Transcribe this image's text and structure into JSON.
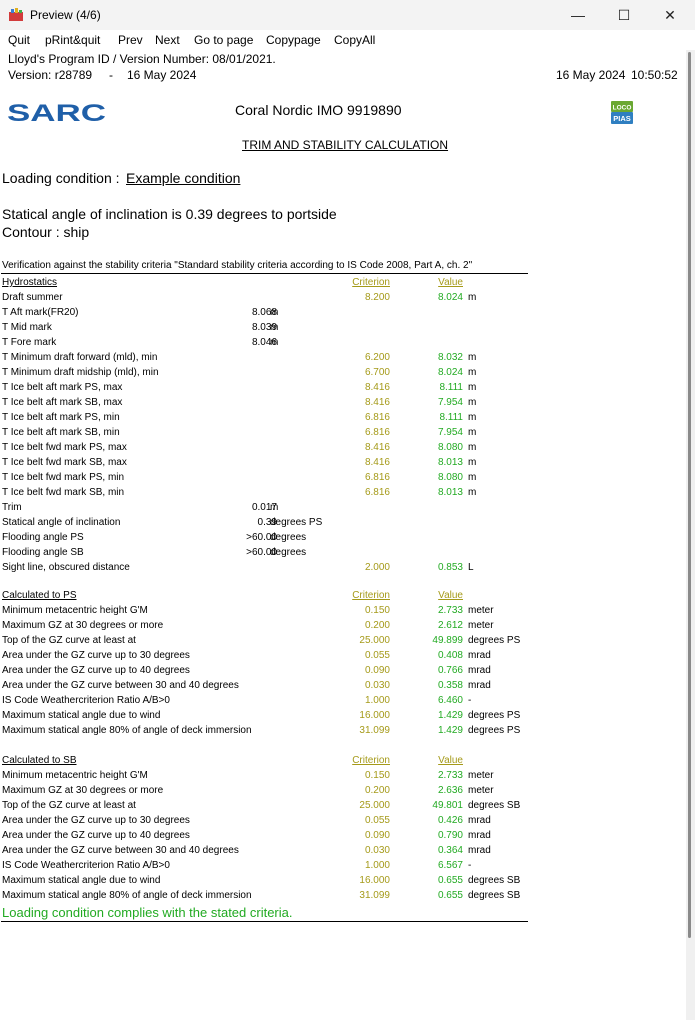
{
  "window": {
    "title": "Preview (4/6)",
    "min_symbol": "—",
    "max_symbol": "☐",
    "close_symbol": "✕",
    "icon": "app-icon"
  },
  "menu": [
    "Quit",
    "pRint&quit",
    "Prev",
    "Next",
    "Go to page",
    "Copypage",
    "CopyAll"
  ],
  "header": {
    "program_id": "Lloyd's Program ID / Version Number: 08/01/2021.",
    "version": "Version: r28789",
    "dash": "-",
    "version_date": "16 May 2024",
    "print_date": "16 May 2024",
    "print_time": "10:50:52",
    "company_logo": "SARC",
    "vessel": "Coral Nordic IMO 9919890",
    "badge_top": "LOCO",
    "badge_bottom": "PIAS",
    "report_title": "TRIM AND STABILITY CALCULATION"
  },
  "loading": {
    "label": "Loading condition :",
    "name": "Example condition",
    "statical": "Statical angle of inclination is 0.39 degrees to portside",
    "contour": "Contour : ship"
  },
  "verification": "Verification against the stability criteria \"Standard stability criteria according to IS Code 2008, Part A, ch. 2\"",
  "hydro": {
    "heading": "Hydrostatics",
    "criterion_header": "Criterion",
    "value_header": "Value",
    "rows": [
      {
        "label": "Draft summer",
        "crit": "8.200",
        "value": "8.024",
        "unit": "m"
      },
      {
        "label": "T Aft mark(FR20)",
        "mid": "8.068",
        "midunit": "m"
      },
      {
        "label": "T Mid mark",
        "mid": "8.039",
        "midunit": "m"
      },
      {
        "label": "T Fore mark",
        "mid": "8.046",
        "midunit": "m"
      },
      {
        "label": "T Minimum draft forward (mld), min",
        "crit": "6.200",
        "value": "8.032",
        "unit": "m"
      },
      {
        "label": "T Minimum draft midship (mld), min",
        "crit": "6.700",
        "value": "8.024",
        "unit": "m"
      },
      {
        "label": "T Ice belt aft mark PS, max",
        "crit": "8.416",
        "value": "8.111",
        "unit": "m"
      },
      {
        "label": "T Ice belt aft mark SB, max",
        "crit": "8.416",
        "value": "7.954",
        "unit": "m"
      },
      {
        "label": "T Ice belt aft mark PS, min",
        "crit": "6.816",
        "value": "8.111",
        "unit": "m"
      },
      {
        "label": "T Ice belt aft mark SB, min",
        "crit": "6.816",
        "value": "7.954",
        "unit": "m"
      },
      {
        "label": "T Ice belt fwd mark PS, max",
        "crit": "8.416",
        "value": "8.080",
        "unit": "m"
      },
      {
        "label": "T Ice belt fwd mark SB, max",
        "crit": "8.416",
        "value": "8.013",
        "unit": "m"
      },
      {
        "label": "T Ice belt fwd mark PS, min",
        "crit": "6.816",
        "value": "8.080",
        "unit": "m"
      },
      {
        "label": "T Ice belt fwd mark SB, min",
        "crit": "6.816",
        "value": "8.013",
        "unit": "m"
      },
      {
        "label": "Trim",
        "mid": "0.017",
        "midunit": "m"
      },
      {
        "label": "Statical angle of inclination",
        "mid": "0.39",
        "midunit": "degrees PS"
      },
      {
        "label": "Flooding angle PS",
        "mid": ">60.00",
        "midunit": "degrees"
      },
      {
        "label": "Flooding angle SB",
        "mid": ">60.00",
        "midunit": "degrees"
      },
      {
        "label": "Sight line, obscured distance",
        "crit": "2.000",
        "value": "0.853",
        "unit": "L"
      }
    ]
  },
  "ps": {
    "heading": "Calculated to PS",
    "criterion_header": "Criterion",
    "value_header": "Value",
    "rows": [
      {
        "label": "Minimum metacentric height G'M",
        "crit": "0.150",
        "value": "2.733",
        "unit": "meter"
      },
      {
        "label": "Maximum GZ at 30 degrees or more",
        "crit": "0.200",
        "value": "2.612",
        "unit": "meter"
      },
      {
        "label": "Top of the GZ curve at least at",
        "crit": "25.000",
        "value": "49.899",
        "unit": "degrees PS"
      },
      {
        "label": "Area under the GZ curve up to 30 degrees",
        "crit": "0.055",
        "value": "0.408",
        "unit": "mrad"
      },
      {
        "label": "Area under the GZ curve up to 40 degrees",
        "crit": "0.090",
        "value": "0.766",
        "unit": "mrad"
      },
      {
        "label": "Area under the GZ curve between 30 and 40 degrees",
        "crit": "0.030",
        "value": "0.358",
        "unit": "mrad"
      },
      {
        "label": "IS Code Weathercriterion Ratio A/B>0",
        "crit": "1.000",
        "value": "6.460",
        "unit": "-"
      },
      {
        "label": "Maximum statical angle due to wind",
        "crit": "16.000",
        "value": "1.429",
        "unit": "degrees PS"
      },
      {
        "label": "Maximum statical angle 80% of angle of deck immersion",
        "crit": "31.099",
        "value": "1.429",
        "unit": "degrees PS"
      }
    ]
  },
  "sb": {
    "heading": "Calculated to SB",
    "criterion_header": "Criterion",
    "value_header": "Value",
    "rows": [
      {
        "label": "Minimum metacentric height G'M",
        "crit": "0.150",
        "value": "2.733",
        "unit": "meter"
      },
      {
        "label": "Maximum GZ at 30 degrees or more",
        "crit": "0.200",
        "value": "2.636",
        "unit": "meter"
      },
      {
        "label": "Top of the GZ curve at least at",
        "crit": "25.000",
        "value": "49.801",
        "unit": "degrees SB"
      },
      {
        "label": "Area under the GZ curve up to 30 degrees",
        "crit": "0.055",
        "value": "0.426",
        "unit": "mrad"
      },
      {
        "label": "Area under the GZ curve up to 40 degrees",
        "crit": "0.090",
        "value": "0.790",
        "unit": "mrad"
      },
      {
        "label": "Area under the GZ curve between 30 and 40 degrees",
        "crit": "0.030",
        "value": "0.364",
        "unit": "mrad"
      },
      {
        "label": "IS Code Weathercriterion Ratio A/B>0",
        "crit": "1.000",
        "value": "6.567",
        "unit": "-"
      },
      {
        "label": "Maximum statical angle due to wind",
        "crit": "16.000",
        "value": "0.655",
        "unit": "degrees SB"
      },
      {
        "label": "Maximum statical angle 80% of angle of deck immersion",
        "crit": "31.099",
        "value": "0.655",
        "unit": "degrees SB"
      }
    ]
  },
  "conclusion": "Loading condition complies with the stated criteria.",
  "colors": {
    "criterion": "#a59a19",
    "value": "#22aa22",
    "sarc_blue": "#1f5fa8",
    "badge_green": "#6aa832",
    "badge_blue": "#2f7fc1"
  }
}
